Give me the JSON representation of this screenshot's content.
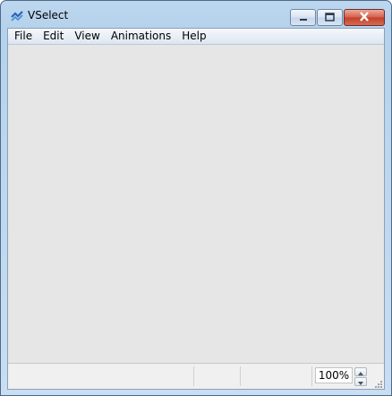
{
  "window": {
    "title": "VSelect",
    "accent": "#c34028"
  },
  "menubar": {
    "items": [
      {
        "label": "File"
      },
      {
        "label": "Edit"
      },
      {
        "label": "View"
      },
      {
        "label": "Animations"
      },
      {
        "label": "Help"
      }
    ]
  },
  "statusbar": {
    "zoom_value": "100%"
  },
  "icons": {
    "app": "vselect-app-icon",
    "minimize": "minimize-icon",
    "maximize": "maximize-icon",
    "close": "close-icon",
    "spin_up": "arrow-up-icon",
    "spin_down": "arrow-down-icon",
    "grip": "resize-grip-icon"
  }
}
